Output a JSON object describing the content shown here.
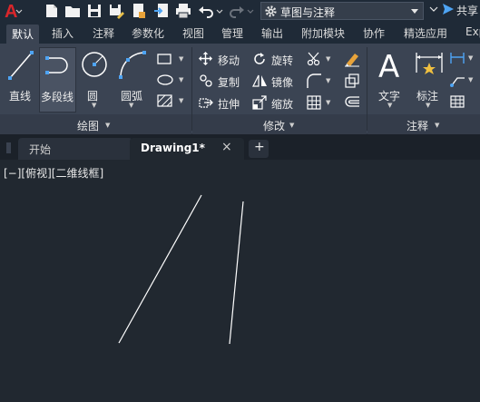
{
  "quick_access": {
    "workspace": "草图与注释",
    "share": "共享"
  },
  "ribbon_tabs": [
    "默认",
    "插入",
    "注释",
    "参数化",
    "视图",
    "管理",
    "输出",
    "附加模块",
    "协作",
    "精选应用",
    "Exp"
  ],
  "panels": {
    "draw": {
      "title": "绘图",
      "tools": [
        "直线",
        "多段线",
        "圆",
        "圆弧"
      ]
    },
    "modify": {
      "title": "修改",
      "tools": [
        "移动",
        "旋转",
        "复制",
        "镜像",
        "拉伸",
        "缩放"
      ]
    },
    "annotation": {
      "title": "注释",
      "tools": [
        "文字",
        "标注"
      ]
    }
  },
  "file_tabs": {
    "start": "开始",
    "active": "Drawing1*",
    "close": "×",
    "new": "+"
  },
  "viewport": {
    "label": "[−][俯视][二维线框]"
  },
  "colors": {
    "accent": "#3f8fe0",
    "logo": "#d9262b",
    "background": "#212830"
  },
  "icons": {
    "app": "autocad-a-icon",
    "new": "new-file-icon",
    "open": "open-folder-icon",
    "save": "save-icon",
    "save_as": "save-as-icon",
    "publish": "publish-icon",
    "import": "import-icon",
    "print": "print-icon",
    "undo": "undo-icon",
    "redo": "redo-icon",
    "workspace": "gear-icon",
    "share": "share-icon"
  }
}
